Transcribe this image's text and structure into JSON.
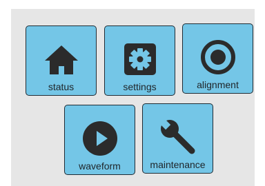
{
  "tiles": {
    "status": {
      "label": "status",
      "icon": "home-icon"
    },
    "settings": {
      "label": "settings",
      "icon": "gear-icon"
    },
    "alignment": {
      "label": "alignment",
      "icon": "target-icon"
    },
    "waveform": {
      "label": "waveform",
      "icon": "play-icon"
    },
    "maintenance": {
      "label": "maintenance",
      "icon": "wrench-icon"
    }
  },
  "colors": {
    "tile_fill": "#74c6e7",
    "tile_border": "#1e2a33",
    "icon": "#2b2b2b",
    "panel_background": "#e6e6e6"
  }
}
